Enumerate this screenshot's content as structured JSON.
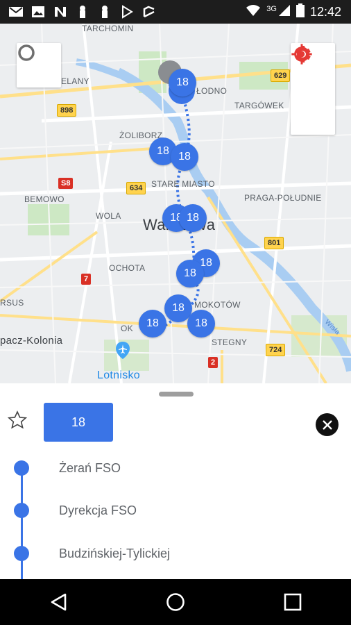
{
  "status_bar": {
    "time": "12:42",
    "network": "3G",
    "notification_icons": [
      "gmail-icon",
      "photos-icon",
      "n-app-icon",
      "keyhole-icon",
      "keyhole-icon",
      "play-store-icon",
      "delivery-icon"
    ]
  },
  "map": {
    "labels": {
      "tarchomin": "TARCHOMIN",
      "bielany": "ELANY",
      "bialoleka": "ŁODNO",
      "targowek": "TARGÓWEK",
      "zoliborz": "ŻOLIBORZ",
      "stare_miasto": "STARE MIASTO",
      "bemowo": "BEMOWO",
      "wola": "WOLA",
      "praga": "PRAGA-POŁUDNIE",
      "warszawa": "Warszawa",
      "ochota": "OCHOTA",
      "ursus": "RSUS",
      "mokotow": "MOKOTÓW",
      "okecie": "OK",
      "stegny": "STEGNY",
      "opacz": "pacz-Kolonia",
      "airport": "Lotnisko"
    },
    "road_badges": {
      "r629": "629",
      "r898": "898",
      "s8": "S8",
      "r634": "634",
      "r801": "801",
      "r7": "7",
      "r724": "724",
      "r2": "2",
      "wisla": "Wisła"
    },
    "cluster_label": "18",
    "colors": {
      "cluster": "#3a74e6",
      "settings_icon": "#e53935"
    }
  },
  "sheet": {
    "line_number": "18",
    "stops": [
      "Żerań FSO",
      "Dyrekcja FSO",
      "Budzińskiej-Tylickiej"
    ]
  }
}
